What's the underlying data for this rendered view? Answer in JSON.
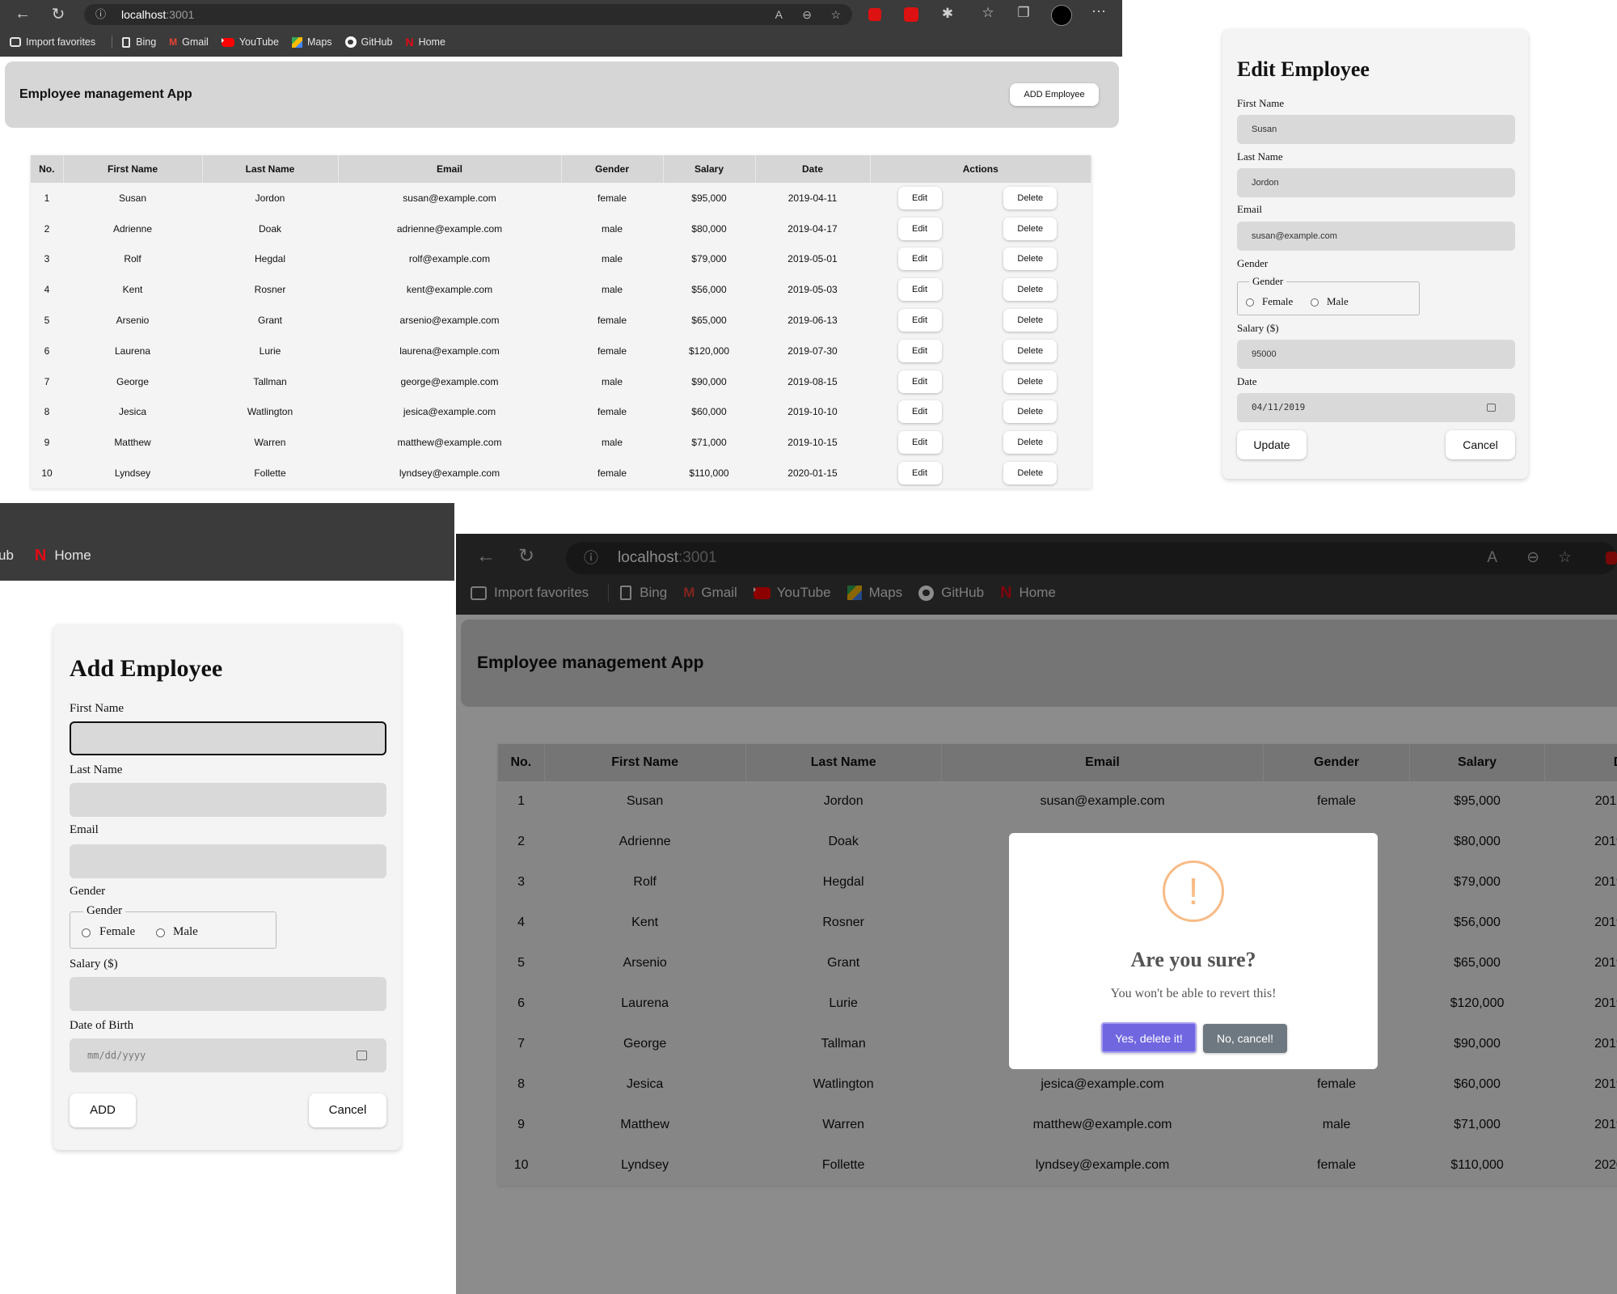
{
  "browser": {
    "url_host": "localhost",
    "url_port": ":3001",
    "bookmarks": [
      {
        "label": "Import favorites",
        "icon": "import-icon"
      },
      {
        "label": "Bing",
        "icon": "page-icon"
      },
      {
        "label": "Gmail",
        "icon": "gmail-icon"
      },
      {
        "label": "YouTube",
        "icon": "youtube-icon"
      },
      {
        "label": "Maps",
        "icon": "maps-icon"
      },
      {
        "label": "GitHub",
        "icon": "github-icon"
      },
      {
        "label": "Home",
        "icon": "netflix-icon"
      }
    ]
  },
  "app": {
    "title": "Employee management App",
    "add_button": "ADD Employee"
  },
  "table": {
    "headers": [
      "No.",
      "First Name",
      "Last Name",
      "Email",
      "Gender",
      "Salary",
      "Date",
      "Actions"
    ],
    "edit_label": "Edit",
    "delete_label": "Delete",
    "rows": [
      [
        "1",
        "Susan",
        "Jordon",
        "susan@example.com",
        "female",
        "$95,000",
        "2019-04-11"
      ],
      [
        "2",
        "Adrienne",
        "Doak",
        "adrienne@example.com",
        "male",
        "$80,000",
        "2019-04-17"
      ],
      [
        "3",
        "Rolf",
        "Hegdal",
        "rolf@example.com",
        "male",
        "$79,000",
        "2019-05-01"
      ],
      [
        "4",
        "Kent",
        "Rosner",
        "kent@example.com",
        "male",
        "$56,000",
        "2019-05-03"
      ],
      [
        "5",
        "Arsenio",
        "Grant",
        "arsenio@example.com",
        "female",
        "$65,000",
        "2019-06-13"
      ],
      [
        "6",
        "Laurena",
        "Lurie",
        "laurena@example.com",
        "female",
        "$120,000",
        "2019-07-30"
      ],
      [
        "7",
        "George",
        "Tallman",
        "george@example.com",
        "male",
        "$90,000",
        "2019-08-15"
      ],
      [
        "8",
        "Jesica",
        "Watlington",
        "jesica@example.com",
        "female",
        "$60,000",
        "2019-10-10"
      ],
      [
        "9",
        "Matthew",
        "Warren",
        "matthew@example.com",
        "male",
        "$71,000",
        "2019-10-15"
      ],
      [
        "10",
        "Lyndsey",
        "Follette",
        "lyndsey@example.com",
        "female",
        "$110,000",
        "2020-01-15"
      ]
    ]
  },
  "edit_form": {
    "title": "Edit Employee",
    "first_name_label": "First Name",
    "first_name_value": "Susan",
    "last_name_label": "Last Name",
    "last_name_value": "Jordon",
    "email_label": "Email",
    "email_value": "susan@example.com",
    "gender_label": "Gender",
    "gender_legend": "Gender",
    "female_label": "Female",
    "male_label": "Male",
    "salary_label": "Salary ($)",
    "salary_value": "95000",
    "date_label": "Date",
    "date_value": "04/11/2019",
    "update_button": "Update",
    "cancel_button": "Cancel"
  },
  "add_form": {
    "title": "Add Employee",
    "first_name_label": "First Name",
    "last_name_label": "Last Name",
    "email_label": "Email",
    "gender_label": "Gender",
    "gender_legend": "Gender",
    "female_label": "Female",
    "male_label": "Male",
    "salary_label": "Salary ($)",
    "dob_label": "Date of Birth",
    "dob_placeholder": "mm/dd/yyyy",
    "add_button": "ADD",
    "cancel_button": "Cancel"
  },
  "confirm_dialog": {
    "icon_text": "!",
    "title": "Are you sure?",
    "message": "You won't be able to revert this!",
    "confirm_button": "Yes, delete it!",
    "cancel_button": "No, cancel!",
    "confirm_color": "#7066e0",
    "cancel_color": "#6e7881"
  }
}
